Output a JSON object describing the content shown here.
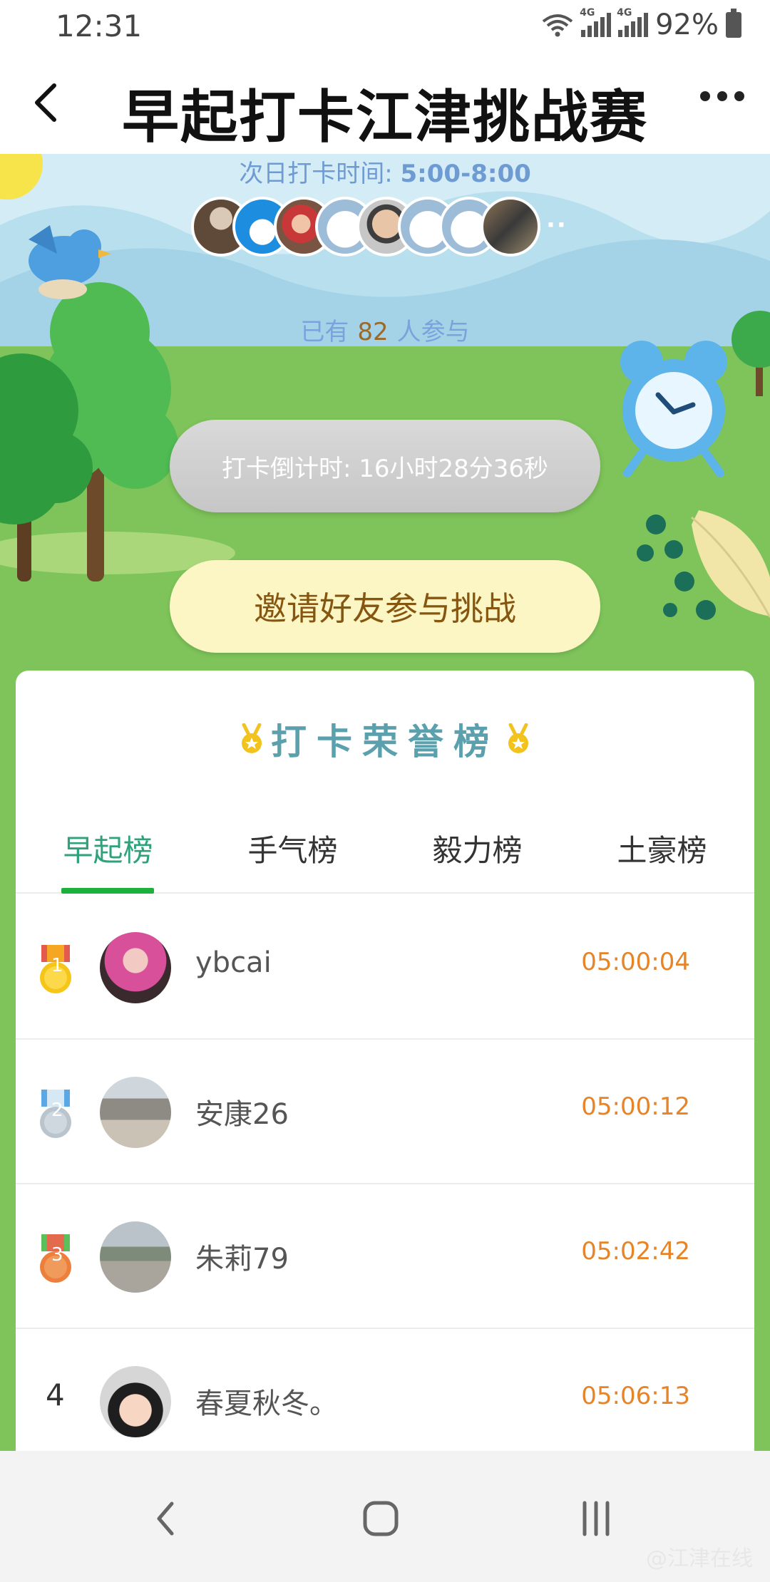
{
  "status_bar": {
    "time": "12:31",
    "network_1": "4G",
    "network_2": "4G",
    "battery": "92%"
  },
  "header": {
    "title": "早起打卡江津挑战赛"
  },
  "hero": {
    "next_label": "次日打卡时间:",
    "next_value": "5:00-8:00",
    "avatars_more": "··",
    "participants_prefix": "已有",
    "participants_count": "82",
    "participants_suffix": "人参与",
    "countdown": "打卡倒计时: 16小时28分36秒",
    "invite": "邀请好友参与挑战"
  },
  "board": {
    "title": "打卡荣誉榜",
    "tabs": [
      {
        "label": "早起榜",
        "active": true
      },
      {
        "label": "手气榜",
        "active": false
      },
      {
        "label": "毅力榜",
        "active": false
      },
      {
        "label": "土豪榜",
        "active": false
      }
    ],
    "rows": [
      {
        "rank": "1",
        "name": "ybcai",
        "time": "05:00:04"
      },
      {
        "rank": "2",
        "name": "安康26",
        "time": "05:00:12"
      },
      {
        "rank": "3",
        "name": "朱莉79",
        "time": "05:02:42"
      },
      {
        "rank": "4",
        "name": "春夏秋冬。",
        "time": "05:06:13"
      }
    ]
  },
  "watermark": "@江津在线",
  "colors": {
    "accent_green": "#1db13c",
    "time_orange": "#e68427",
    "grass": "#7ec45a"
  }
}
